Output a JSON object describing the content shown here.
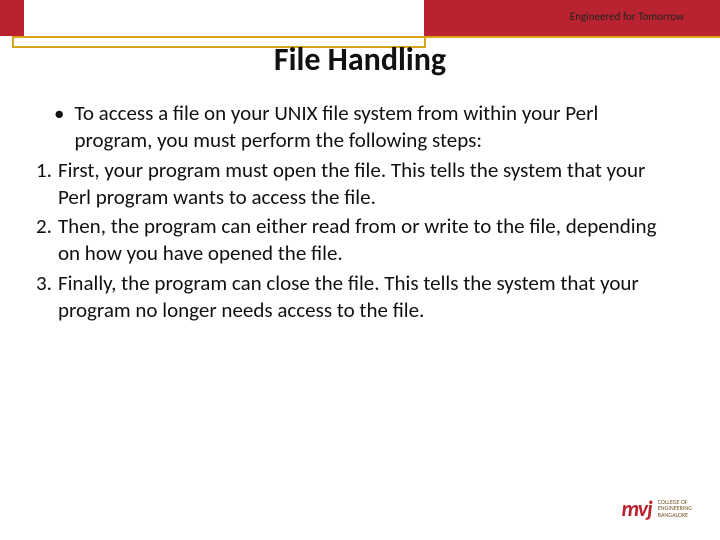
{
  "header": {
    "tagline": "Engineered for Tomorrow",
    "title": "File Handling"
  },
  "content": {
    "bullet1": "To access a file on your UNIX file system from within your Perl program, you must perform the following steps:",
    "step1_num": "1.",
    "step1": "First, your program must open the file. This tells the system that your Perl program wants to access the file.",
    "step2_num": "2.",
    "step2": "Then, the program can either read from or write to the file,  depending on how you have opened the file.",
    "step3_num": "3.",
    "step3": "Finally, the program can close the file. This tells the system that your program no longer needs access to the file."
  },
  "logo": {
    "mark": "mvj",
    "line1": "College of",
    "line2": "Engineering",
    "line3": "Bangalore"
  }
}
